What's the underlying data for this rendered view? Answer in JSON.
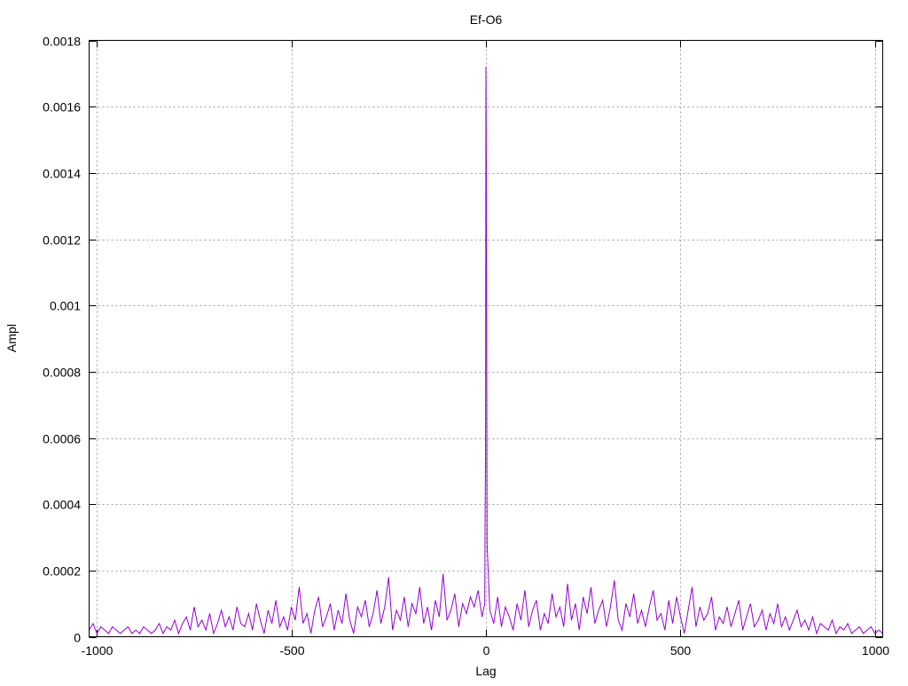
{
  "chart_data": {
    "type": "line",
    "title": "Ef-O6",
    "xlabel": "Lag",
    "ylabel": "Ampl",
    "xlim": [
      -1020,
      1020
    ],
    "ylim": [
      0,
      0.0018
    ],
    "grid": true,
    "x_ticks": [
      -1000,
      -500,
      0,
      500,
      1000
    ],
    "x_tick_labels": [
      "-1000",
      "-500",
      "0",
      "500",
      "1000"
    ],
    "y_ticks": [
      0,
      0.0002,
      0.0004,
      0.0006,
      0.0008,
      0.001,
      0.0012,
      0.0014,
      0.0016,
      0.0018
    ],
    "y_tick_labels": [
      "0",
      "0.0002",
      "0.0004",
      "0.0006",
      "0.0008",
      "0.001",
      "0.0012",
      "0.0014",
      "0.0016",
      "0.0018"
    ],
    "series": [
      {
        "name": "Ampl",
        "color": "#9400d3",
        "y_multiplier": 1e-05,
        "left": {
          "x_start": -1020,
          "x_step": 10,
          "y": [
            2,
            4,
            1,
            3,
            2,
            1,
            3,
            2,
            1,
            2,
            3,
            1,
            2,
            1,
            3,
            2,
            1,
            2,
            4,
            1,
            3,
            2,
            5,
            1,
            4,
            6,
            2,
            9,
            3,
            5,
            2,
            7,
            1,
            4,
            8,
            3,
            6,
            2,
            9,
            4,
            3,
            7,
            2,
            10,
            5,
            1,
            8,
            4,
            11,
            3,
            6,
            2,
            9,
            5,
            15,
            4,
            7,
            1,
            8,
            12,
            3,
            6,
            10,
            2,
            8,
            4,
            13,
            5,
            1,
            9,
            6,
            11,
            3,
            7,
            14,
            4,
            9,
            18,
            2,
            8,
            5,
            12,
            3,
            10,
            7,
            15,
            4,
            9,
            2,
            11,
            6,
            19,
            5,
            8,
            13,
            3,
            10,
            7,
            12,
            9,
            14,
            6
          ]
        },
        "peak": {
          "x": [
            -3,
            -2,
            -1,
            0,
            1,
            2,
            3
          ],
          "y": [
            10,
            37,
            56,
            172,
            147,
            86,
            28
          ]
        },
        "right": {
          "x_start": 10,
          "x_step": 10,
          "y": [
            8,
            4,
            12,
            3,
            9,
            6,
            2,
            10,
            5,
            14,
            3,
            8,
            11,
            2,
            7,
            4,
            13,
            6,
            9,
            3,
            16,
            5,
            10,
            2,
            12,
            7,
            15,
            4,
            8,
            11,
            3,
            9,
            17,
            5,
            2,
            10,
            6,
            13,
            4,
            8,
            3,
            9,
            14,
            5,
            7,
            2,
            11,
            4,
            12,
            6,
            1,
            8,
            15,
            3,
            9,
            5,
            7,
            12,
            2,
            6,
            4,
            9,
            3,
            7,
            11,
            2,
            6,
            10,
            3,
            5,
            8,
            2,
            7,
            4,
            10,
            3,
            6,
            2,
            5,
            8,
            3,
            5,
            2,
            6,
            1,
            4,
            3,
            2,
            5,
            1,
            3,
            2,
            4,
            1,
            2,
            3,
            1,
            2,
            3,
            1,
            2,
            1
          ]
        }
      }
    ]
  }
}
